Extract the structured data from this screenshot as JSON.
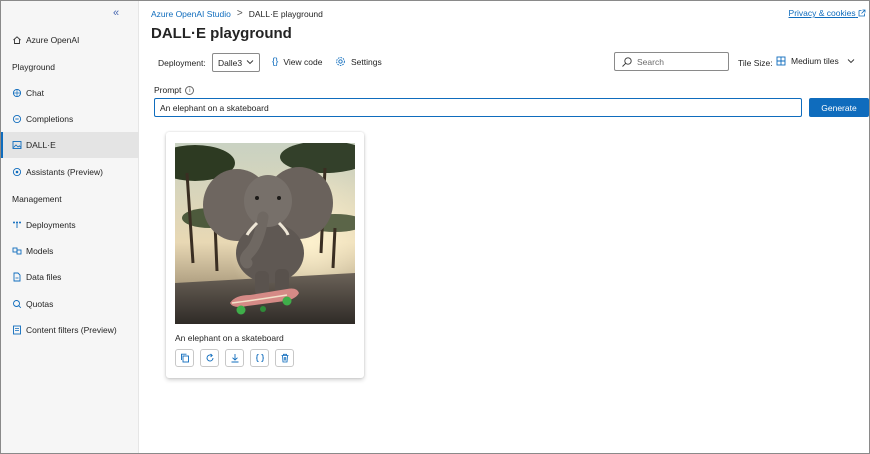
{
  "sidebar": {
    "collapse_glyph": "«",
    "items": [
      {
        "label": "Azure OpenAI",
        "icon": "home-icon",
        "kind": "item"
      },
      {
        "label": "Playground",
        "kind": "heading"
      },
      {
        "label": "Chat",
        "icon": "chat-icon",
        "kind": "item"
      },
      {
        "label": "Completions",
        "icon": "completions-icon",
        "kind": "item"
      },
      {
        "label": "DALL·E",
        "icon": "image-icon",
        "kind": "item",
        "active": true
      },
      {
        "label": "Assistants (Preview)",
        "icon": "assistant-icon",
        "kind": "item"
      },
      {
        "label": "Management",
        "kind": "heading"
      },
      {
        "label": "Deployments",
        "icon": "deployments-icon",
        "kind": "item"
      },
      {
        "label": "Models",
        "icon": "models-icon",
        "kind": "item"
      },
      {
        "label": "Data files",
        "icon": "data-files-icon",
        "kind": "item"
      },
      {
        "label": "Quotas",
        "icon": "quotas-icon",
        "kind": "item"
      },
      {
        "label": "Content filters (Preview)",
        "icon": "content-filter-icon",
        "kind": "item"
      }
    ]
  },
  "header": {
    "breadcrumb": [
      "Azure OpenAI Studio",
      "DALL·E playground"
    ],
    "breadcrumb_separator": ">",
    "privacy_link": "Privacy & cookies",
    "title": "DALL·E playground"
  },
  "toolbar": {
    "deployment_label": "Deployment:",
    "deployment_value": "Dalle3",
    "view_code_label": "View code",
    "settings_label": "Settings",
    "search_placeholder": "Search",
    "tile_size_label": "Tile Size:",
    "tile_size_value": "Medium tiles"
  },
  "prompt": {
    "label": "Prompt",
    "value": "An elephant on a skateboard",
    "generate_label": "Generate"
  },
  "results": [
    {
      "caption": "An elephant on a skateboard",
      "actions": [
        "copy-icon",
        "regenerate-icon",
        "download-icon",
        "code-icon",
        "delete-icon"
      ]
    }
  ],
  "colors": {
    "accent": "#0f6cbd",
    "sidebar_bg": "#f6f6f6",
    "active_bg": "#e4e4e4"
  }
}
